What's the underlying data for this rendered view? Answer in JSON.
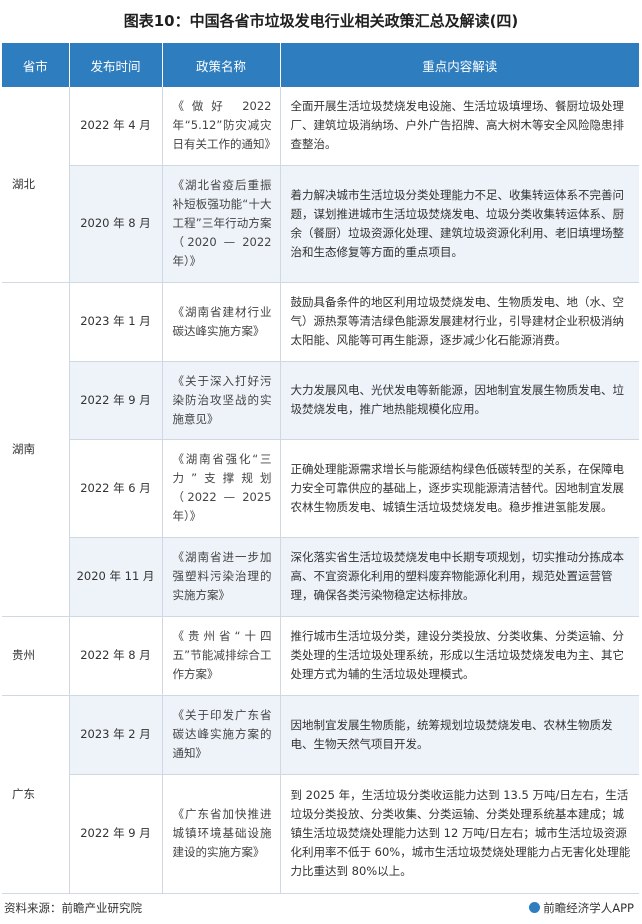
{
  "title": "图表10：中国各省市垃圾发电行业相关政策汇总及解读(四)",
  "headers": [
    "省市",
    "发布时间",
    "政策名称",
    "重点内容解读"
  ],
  "provinces": [
    "湖北",
    "湖南",
    "贵州",
    "广东"
  ],
  "rows": [
    {
      "date": "2022 年 4 月",
      "name": "《做好 2022 年“5.12”防灾减灾日有关工作的通知》",
      "content": "全面开展生活垃圾焚烧发电设施、生活垃圾填埋场、餐厨垃圾处理厂、建筑垃圾消纳场、户外广告招牌、高大树木等安全风险隐患排查整治。"
    },
    {
      "date": "2020 年 8 月",
      "name": "《湖北省疫后重振补短板强功能“十大工程”三年行动方案（2020 — 2022 年）》",
      "content": "着力解决城市生活垃圾分类处理能力不足、收集转运体系不完善问题，谋划推进城市生活垃圾焚烧发电、垃圾分类收集转运体系、厨余（餐厨）垃圾资源化处理、建筑垃圾资源化利用、老旧填埋场整治和生态修复等方面的重点项目。"
    },
    {
      "date": "2023 年 1 月",
      "name": "《湖南省建材行业碳达峰实施方案》",
      "content": "鼓励具备条件的地区利用垃圾焚烧发电、生物质发电、地（水、空气）源热泵等清洁绿色能源发展建材行业，引导建材企业积极消纳太阳能、风能等可再生能源，逐步减少化石能源消费。"
    },
    {
      "date": "2022 年 9 月",
      "name": "《关于深入打好污染防治攻坚战的实施意见》",
      "content": "大力发展风电、光伏发电等新能源，因地制宜发展生物质发电、垃圾焚烧发电，推广地热能规模化应用。"
    },
    {
      "date": "2022 年 6 月",
      "name": "《湖南省强化“三力”支撑规划（2022 — 2025 年）》",
      "content": "正确处理能源需求增长与能源结构绿色低碳转型的关系，在保障电力安全可靠供应的基础上，逐步实现能源清洁替代。因地制宜发展农林生物质发电、城镇生活垃圾焚烧发电。稳步推进氢能发展。"
    },
    {
      "date": "2020 年 11 月",
      "name": "《湖南省进一步加强塑料污染治理的实施方案》",
      "content": "深化落实省生活垃圾焚烧发电中长期专项规划，切实推动分拣成本高、不宜资源化利用的塑料废弃物能源化利用，规范处置运营管理，确保各类污染物稳定达标排放。"
    },
    {
      "date": "2022 年 8 月",
      "name": "《贵州省“十四五”节能减排综合工作方案》",
      "content": "推行城市生活垃圾分类，建设分类投放、分类收集、分类运输、分类处理的生活垃圾处理系统，形成以生活垃圾焚烧发电为主、其它处理方式为辅的生活垃圾处理模式。"
    },
    {
      "date": "2023 年 2 月",
      "name": "《关于印发广东省碳达峰实施方案的通知》",
      "content": "因地制宜发展生物质能，统筹规划垃圾焚烧发电、农林生物质发电、生物天然气项目开发。"
    },
    {
      "date": "2022 年 9 月",
      "name": "《广东省加快推进城镇环境基础设施建设的实施方案》",
      "content": "到 2025 年，生活垃圾分类收运能力达到 13.5 万吨/日左右，生活垃圾分类投放、分类收集、分类运输、分类处理系统基本建成；城镇生活垃圾焚烧处理能力达到 12 万吨/日左右；城市生活垃圾资源化利用率不低于 60%，城市生活垃圾焚烧处理能力占无害化处理能力比重达到 80%以上。"
    }
  ],
  "footer": {
    "source": "资料来源：前瞻产业研究院",
    "brand": "前瞻经济学人APP"
  },
  "colors": {
    "header": "#2e7dbf",
    "shade": "#eef3f9",
    "border": "#cfd8e3"
  }
}
